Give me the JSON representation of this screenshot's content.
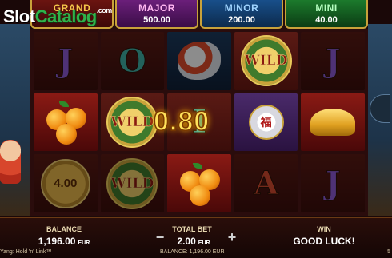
{
  "logo": {
    "part1": "Slot",
    "part2": "Catalog",
    "suffix": ".com"
  },
  "jackpots": [
    {
      "name": "GRAND",
      "value": ""
    },
    {
      "name": "MAJOR",
      "value": "500.00"
    },
    {
      "name": "MINOR",
      "value": "200.00"
    },
    {
      "name": "MINI",
      "value": "40.00"
    }
  ],
  "reels": [
    [
      "J",
      "orange",
      "coin"
    ],
    [
      "O",
      "WILD",
      "WILD"
    ],
    [
      "koi",
      "I",
      "orange"
    ],
    [
      "WILD",
      "cup",
      "A"
    ],
    [
      "J",
      "ingot",
      "J"
    ]
  ],
  "symbols": {
    "wild_label": "WILD",
    "coin_value": "4.00",
    "cup_glyph": "福"
  },
  "win_amount": "0.80",
  "bottom_bar": {
    "balance_label": "BALANCE",
    "balance_value": "1,196.00",
    "currency": "EUR",
    "bet_label": "TOTAL BET",
    "bet_value": "2.00",
    "bet_minus": "−",
    "bet_plus": "+",
    "win_label": "WIN",
    "win_value": "GOOD LUCK!"
  },
  "footer": {
    "game_name": "Yang: Hold 'n' Link™",
    "balance_text": "BALANCE: 1,196.00 EUR",
    "right_text": "5"
  },
  "colors": {
    "win_text": "#ffe25a",
    "gold_frame": "#c9a23a"
  }
}
